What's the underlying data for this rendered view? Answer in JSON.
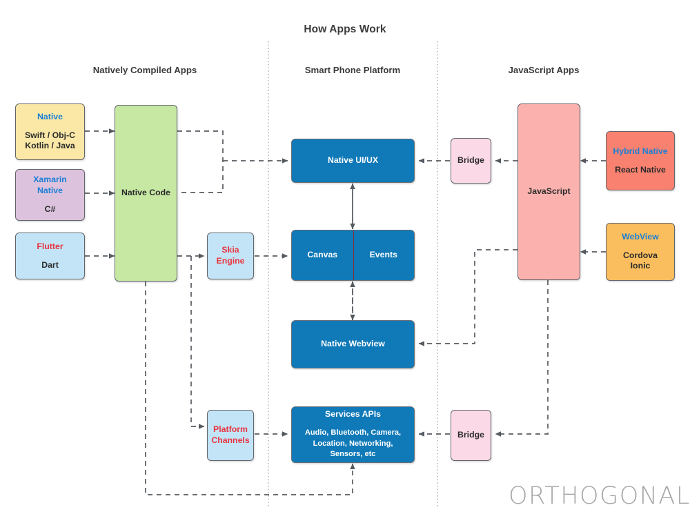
{
  "diagram": {
    "title": "How Apps Work",
    "columns": [
      {
        "label": "Natively Compiled Apps"
      },
      {
        "label": "Smart Phone Platform"
      },
      {
        "label": "JavaScript Apps"
      }
    ],
    "logo": {
      "text": "ORTHOGONAL",
      "trademark": "™"
    }
  },
  "colors": {
    "yellow": "#fbe8a7",
    "purple": "#dcc2dd",
    "lightblue": "#c3e4f7",
    "green": "#c6e8a3",
    "blue": "#1079b8",
    "salmon": "#f9816f",
    "pink_light": "#fcd9e7",
    "pink_mid": "#fbb2ae",
    "orange": "#fbbe5e",
    "stroke": "#62656b",
    "wire": "#555a60",
    "title_text": "#3b3b3b",
    "accent_blue_text": "#1a7fd4",
    "accent_red_text": "#e8343f",
    "logo_gray": "#a6a6a6"
  },
  "nodes": {
    "native": {
      "head": "Native",
      "line1": "Swift / Obj-C",
      "line2": "Kotlin / Java"
    },
    "xamarin": {
      "head1": "Xamarin",
      "head2": "Native",
      "line1": "C#"
    },
    "flutter": {
      "head": "Flutter",
      "line1": "Dart"
    },
    "native_code": {
      "label": "Native Code"
    },
    "skia": {
      "line1": "Skia",
      "line2": "Engine"
    },
    "platform_channels": {
      "line1": "Platform",
      "line2": "Channels"
    },
    "native_ui_ux": {
      "label": "Native UI/UX"
    },
    "canvas": {
      "label": "Canvas"
    },
    "events": {
      "label": "Events"
    },
    "native_webview": {
      "label": "Native Webview"
    },
    "services_apis": {
      "head": "Services APIs",
      "line1": "Audio, Bluetooth, Camera,",
      "line2": "Location, Networking,",
      "line3": "Sensors, etc"
    },
    "bridge_top": {
      "label": "Bridge"
    },
    "bridge_bottom": {
      "label": "Bridge"
    },
    "javascript": {
      "label": "JavaScript"
    },
    "react_native": {
      "head1": "Hybrid Native",
      "line1": "React Native"
    },
    "cordova": {
      "head": "WebView",
      "line1": "Cordova",
      "line2": "Ionic"
    }
  }
}
